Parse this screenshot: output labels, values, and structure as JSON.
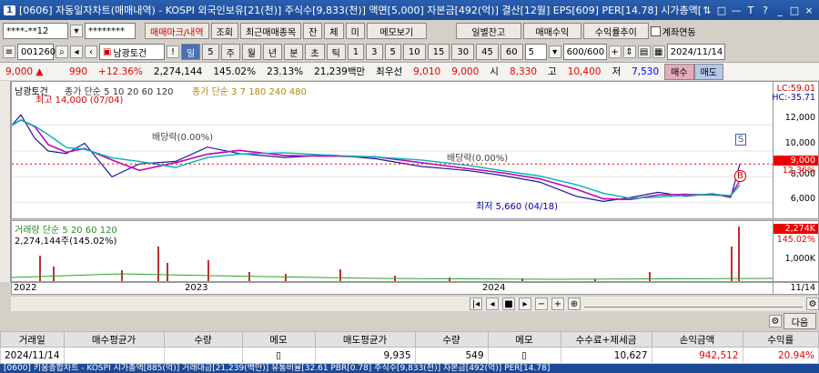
{
  "window": {
    "number": "1",
    "title": "[0606] 자동일자차트(매매내역) - KOSPI 외국인보유[21(천)] 주식수[9,833(천)] 액면[5,000] 자본금[492(억)] 결산[12월] EPS[609] PER[14.78] 시가총액[8",
    "controls": [
      "⇅",
      "□",
      "—",
      "T",
      "?",
      "_",
      "□",
      "×"
    ]
  },
  "toolbar1": {
    "account": "****-**12",
    "password": "********",
    "buttons": [
      "매매마크/내역",
      "조회",
      "최근매매종목",
      "잔",
      "체",
      "미",
      "메모보기",
      "일별잔고",
      "매매수익",
      "수익률추이"
    ],
    "checkbox_label": "계좌연동"
  },
  "toolbar2": {
    "code": "001260",
    "name": "남광토건",
    "period_buttons": [
      "일",
      "5",
      "주",
      "월",
      "년",
      "분",
      "초",
      "틱"
    ],
    "interval_buttons": [
      "1",
      "3",
      "5",
      "10",
      "15",
      "30",
      "45",
      "60"
    ],
    "interval_value": "5",
    "count": "600/600",
    "date": "2024/11/14"
  },
  "quote": {
    "price": "9,000 ▲",
    "change": "990",
    "change_pct": "+12.36%",
    "volume": "2,274,144",
    "volume_ratio": "145.02%",
    "turnover": "23.13%",
    "amount": "21,239백만",
    "best_ask_label": "최우선",
    "best_ask": "9,010",
    "best_bid": "9,000",
    "open_label": "시",
    "open": "8,330",
    "high_label": "고",
    "high": "10,400",
    "low_label": "저",
    "low": "7,530",
    "buy_label": "매수",
    "sell_label": "매도"
  },
  "chart": {
    "legend_name": "남광토건",
    "legend_ma": "종가 단순 5 10 20 60 120",
    "legend_ma2": "종가 단순 3 7 180 240 480",
    "high_note": "최고 14,000 (07/04)",
    "low_note": "최저 5,660 (04/18)",
    "dividend1": "배당락(0.00%)",
    "dividend2": "배당락(0.00%)",
    "right_top1": "LC:59.01",
    "right_top2": "HC:-35.71",
    "y_ticks": [
      "12,000",
      "10,000",
      "8,000",
      "6,000"
    ],
    "last_price": "9,000",
    "last_pct": "12.36%",
    "signal_s": "S",
    "signal_b": "B"
  },
  "volume_panel": {
    "legend": "거래량 단순 5 20 60 120",
    "current": "2,274,144주(145.02%)",
    "last_value": "2,274K",
    "last_pct": "145.02%",
    "tick": "1,000K"
  },
  "xaxis": {
    "labels": [
      "2022",
      "2023",
      "2024"
    ],
    "right_label": "11/14"
  },
  "table": {
    "next_label": "다음",
    "headers": [
      "거래일",
      "매수평균가",
      "수량",
      "메모",
      "매도평균가",
      "수량",
      "메모",
      "수수료+제세금",
      "손익금액",
      "수익률"
    ],
    "rows": [
      [
        "2024/11/14",
        "",
        "",
        "",
        "9,935",
        "549",
        "",
        "10,627",
        "942,512",
        "20.94%"
      ]
    ]
  },
  "bottom": {
    "text": "[0600] 키움종합차트 - KOSPI 시가총액[885(억)] 거래대금[21,239(백만)] 유통비율[32.61 PBR[0.78] 주식수[9,833(천)] 자본금[492(억)] PER[14.78]"
  },
  "chart_data": {
    "type": "line",
    "title": "",
    "series": [
      {
        "name": "종가",
        "points": [
          [
            0,
            12000
          ],
          [
            10,
            12800
          ],
          [
            25,
            11000
          ],
          [
            40,
            10000
          ],
          [
            60,
            9800
          ],
          [
            80,
            10600
          ],
          [
            110,
            8000
          ],
          [
            140,
            9000
          ],
          [
            180,
            9200
          ],
          [
            215,
            10300
          ],
          [
            250,
            9800
          ],
          [
            300,
            9500
          ],
          [
            350,
            9700
          ],
          [
            400,
            9400
          ],
          [
            450,
            8800
          ],
          [
            500,
            8500
          ],
          [
            540,
            8100
          ],
          [
            580,
            7600
          ],
          [
            620,
            6500
          ],
          [
            650,
            6100
          ],
          [
            680,
            6400
          ],
          [
            710,
            6800
          ],
          [
            740,
            6500
          ],
          [
            770,
            6700
          ],
          [
            790,
            6400
          ],
          [
            800,
            9000
          ]
        ]
      }
    ],
    "ylim": [
      5000,
      15000
    ]
  }
}
